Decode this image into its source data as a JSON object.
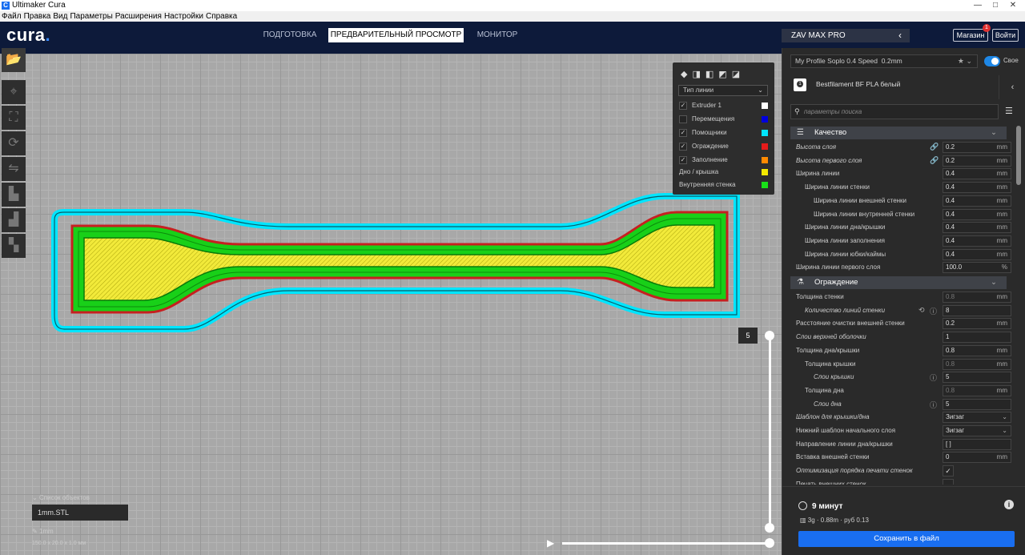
{
  "window": {
    "title": "Ultimaker Cura",
    "app_icon": "C",
    "controls": [
      "—",
      "□",
      "✕"
    ]
  },
  "menu": [
    "Файл",
    "Правка",
    "Вид",
    "Параметры",
    "Расширения",
    "Настройки",
    "Справка"
  ],
  "header": {
    "logo_text": "cura",
    "logo_dot": ".",
    "stages": [
      "ПОДГОТОВКА",
      "ПРЕДВАРИТЕЛЬНЫЙ ПРОСМОТР",
      "МОНИТОР"
    ],
    "active_stage": "ПРЕДВАРИТЕЛЬНЫЙ ПРОСМОТР",
    "machine": "ZAV MAX PRO",
    "machine_chevron": "‹",
    "marketplace": "Магазин",
    "marketplace_badge": "1",
    "login": "Войти"
  },
  "legend": {
    "view_type": "Тип линии",
    "items": [
      {
        "label": "Extruder 1",
        "checked": true,
        "color": "#ffffff"
      },
      {
        "label": "Перемещения",
        "checked": false,
        "color": "#0000dd"
      },
      {
        "label": "Помощники",
        "checked": true,
        "color": "#00e5ff"
      },
      {
        "label": "Ограждение",
        "checked": true,
        "color": "#e51b1b"
      },
      {
        "label": "Заполнение",
        "checked": true,
        "color": "#ff8a00"
      },
      {
        "label": "Дно / крышка",
        "checked": null,
        "color": "#f2e800"
      },
      {
        "label": "Внутренняя стенка",
        "checked": null,
        "color": "#18e018"
      }
    ]
  },
  "layer_view": {
    "current_layer": "5"
  },
  "object_list": {
    "header": "Список объектов",
    "items": [
      "1mm.STL"
    ],
    "selected_name": "1mm",
    "dimensions": "150.0 x 20.0 x 1.0 мм"
  },
  "print_settings": {
    "profile": "My Profile Soplo 0.4 Speed",
    "layer_height": "0.2mm",
    "custom_toggle": "Свое",
    "material": "Bestfilament BF PLA белый",
    "search_placeholder": "параметры поиска",
    "categories": [
      {
        "name": "Качество",
        "rows": [
          {
            "label": "Высота слоя",
            "indent": 0,
            "italic": true,
            "link": true,
            "value": "0.2",
            "unit": "mm"
          },
          {
            "label": "Высота первого слоя",
            "indent": 0,
            "italic": true,
            "link": true,
            "value": "0.2",
            "unit": "mm"
          },
          {
            "label": "Ширина линии",
            "indent": 0,
            "value": "0.4",
            "unit": "mm"
          },
          {
            "label": "Ширина линии стенки",
            "indent": 1,
            "value": "0.4",
            "unit": "mm"
          },
          {
            "label": "Ширина линии внешней стенки",
            "indent": 2,
            "value": "0.4",
            "unit": "mm"
          },
          {
            "label": "Ширина линии внутренней стенки",
            "indent": 2,
            "value": "0.4",
            "unit": "mm"
          },
          {
            "label": "Ширина линии дна/крышки",
            "indent": 1,
            "value": "0.4",
            "unit": "mm"
          },
          {
            "label": "Ширина линии заполнения",
            "indent": 1,
            "value": "0.4",
            "unit": "mm"
          },
          {
            "label": "Ширина линии юбки/каймы",
            "indent": 1,
            "value": "0.4",
            "unit": "mm"
          },
          {
            "label": "Ширина линии первого слоя",
            "indent": 0,
            "value": "100.0",
            "unit": "%"
          }
        ]
      },
      {
        "name": "Ограждение",
        "rows": [
          {
            "label": "Толщина стенки",
            "indent": 0,
            "value": "0.8",
            "unit": "mm",
            "disabled": true
          },
          {
            "label": "Количество линий стенки",
            "indent": 1,
            "italic": true,
            "reset": true,
            "info": true,
            "value": "8"
          },
          {
            "label": "Расстояние очистки внешней стенки",
            "indent": 0,
            "value": "0.2",
            "unit": "mm"
          },
          {
            "label": "Слои верхней оболочки",
            "indent": 0,
            "italic": true,
            "value": "1"
          },
          {
            "label": "Толщина дна/крышки",
            "indent": 0,
            "value": "0.8",
            "unit": "mm"
          },
          {
            "label": "Толщина крышки",
            "indent": 1,
            "value": "0.8",
            "unit": "mm",
            "disabled": true
          },
          {
            "label": "Слои крышки",
            "indent": 2,
            "italic": true,
            "info": true,
            "value": "5"
          },
          {
            "label": "Толщина дна",
            "indent": 1,
            "value": "0.8",
            "unit": "mm",
            "disabled": true
          },
          {
            "label": "Слои дна",
            "indent": 2,
            "italic": true,
            "info": true,
            "value": "5"
          },
          {
            "label": "Шаблон для крышки/дна",
            "indent": 0,
            "italic": true,
            "value": "Зигзаг",
            "dropdown": true
          },
          {
            "label": "Нижний шаблон начального слоя",
            "indent": 0,
            "value": "Зигзаг",
            "dropdown": true
          },
          {
            "label": "Направление линии дна/крышки",
            "indent": 0,
            "value": "[ ]"
          },
          {
            "label": "Вставка внешней стенки",
            "indent": 0,
            "value": "0",
            "unit": "mm"
          },
          {
            "label": "Оптимизация порядка печати стенок",
            "indent": 0,
            "italic": true,
            "check": true,
            "value": "✓"
          },
          {
            "label": "Печать внешних стенок",
            "indent": 0,
            "check": true,
            "value": ""
          }
        ]
      }
    ]
  },
  "estimate": {
    "time": "9 минут",
    "filament": "3g · 0.88m · руб 0.13",
    "save_label": "Сохранить в файл"
  }
}
